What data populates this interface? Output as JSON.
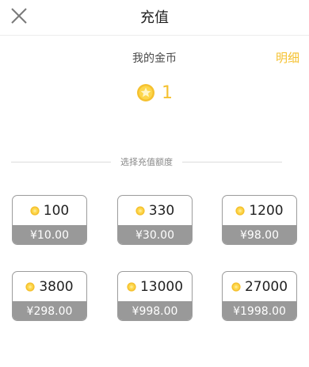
{
  "header": {
    "close_icon": "close-icon",
    "title": "充值"
  },
  "wallet": {
    "label": "我的金币",
    "detail_link": "明细",
    "balance": "1",
    "coin_icon": "gold-coin-icon"
  },
  "section": {
    "label": "选择充值额度"
  },
  "packages": [
    {
      "amount": "100",
      "price": "¥10.00"
    },
    {
      "amount": "330",
      "price": "¥30.00"
    },
    {
      "amount": "1200",
      "price": "¥98.00"
    },
    {
      "amount": "3800",
      "price": "¥298.00"
    },
    {
      "amount": "13000",
      "price": "¥998.00"
    },
    {
      "amount": "27000",
      "price": "¥1998.00"
    }
  ],
  "colors": {
    "accent": "#f5c12f",
    "price_bar": "#999999",
    "border": "#9c9c9c"
  }
}
